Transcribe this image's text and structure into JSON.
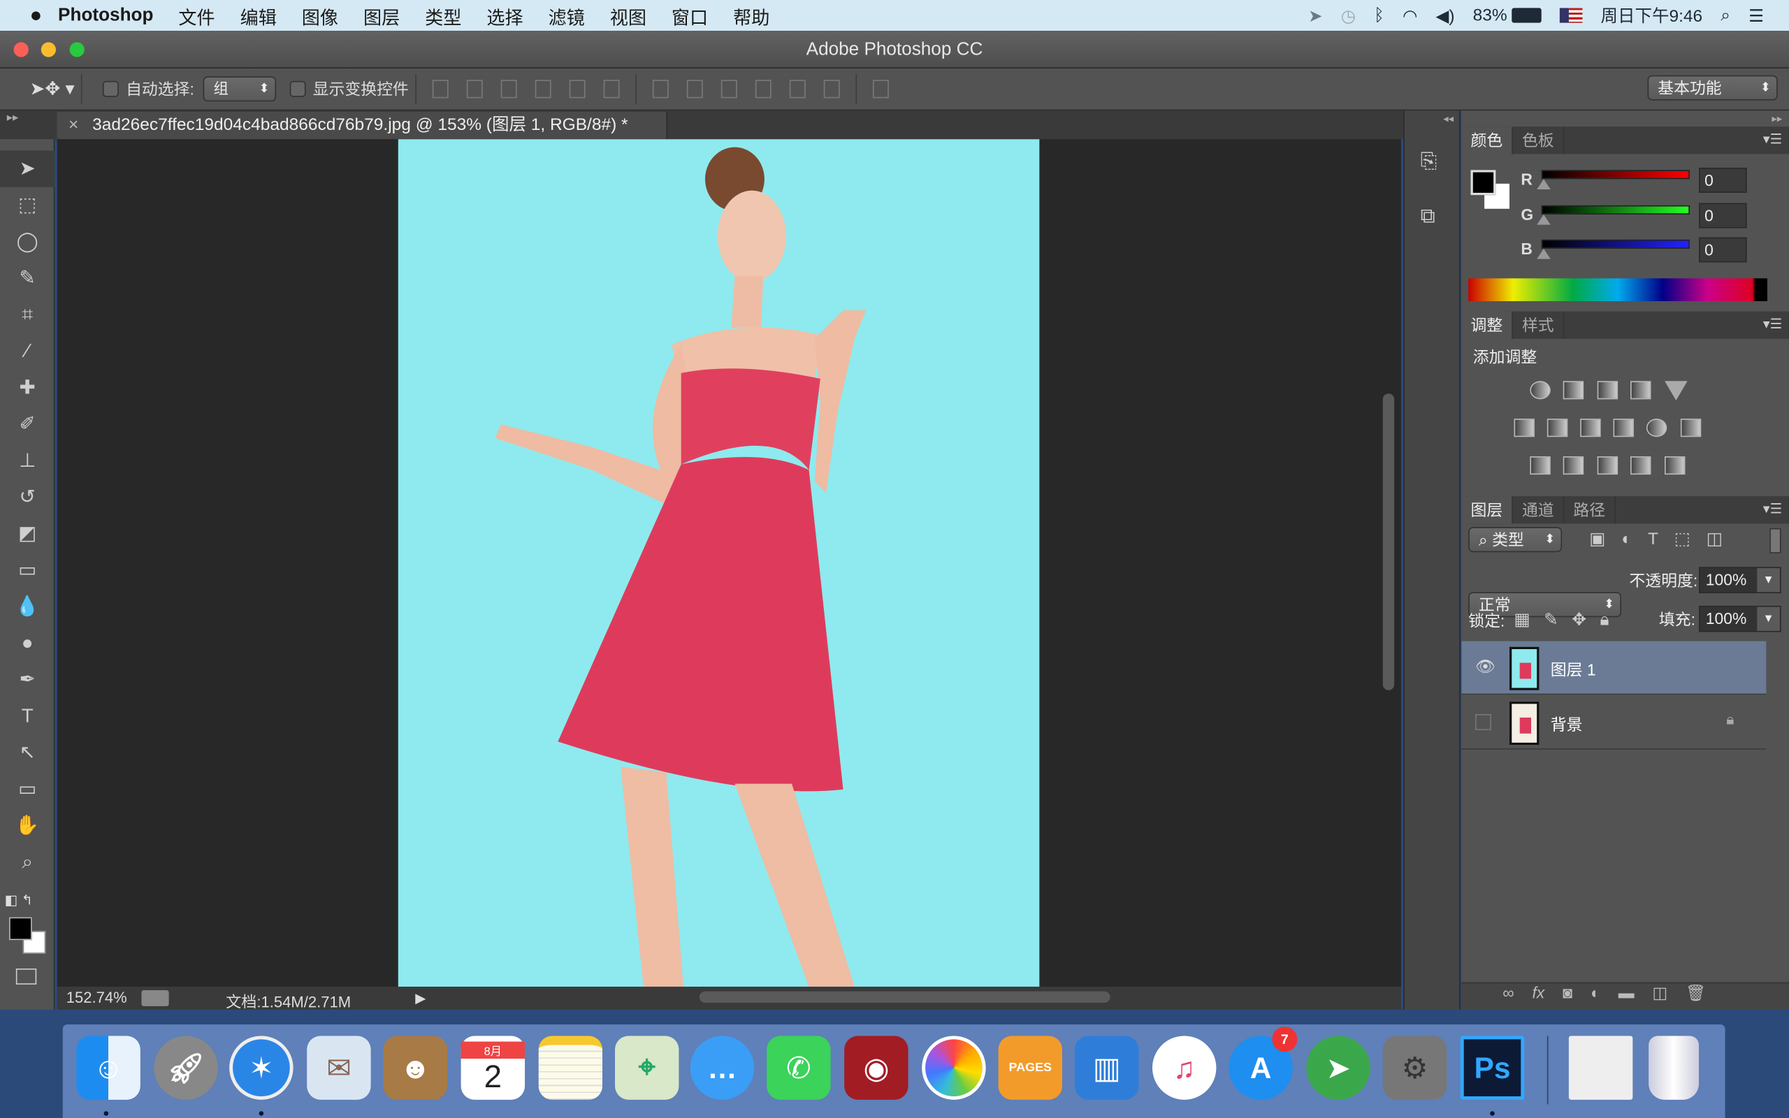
{
  "menubar": {
    "app": "Photoshop",
    "items": [
      "文件",
      "编辑",
      "图像",
      "图层",
      "类型",
      "选择",
      "滤镜",
      "视图",
      "窗口",
      "帮助"
    ],
    "battery": "83%",
    "clock": "周日下午9:46"
  },
  "window": {
    "title": "Adobe Photoshop CC"
  },
  "options": {
    "auto_select_label": "自动选择:",
    "auto_select_value": "组",
    "show_transform_label": "显示变换控件",
    "workspace": "基本功能"
  },
  "document": {
    "tab": "3ad26ec7ffec19d04c4bad866cd76b79.jpg @ 153% (图层 1, RGB/8#) *",
    "close": "×",
    "background_color": "#8eeaee"
  },
  "status": {
    "zoom": "152.74%",
    "doc_size": "文档:1.54M/2.71M"
  },
  "color_panel": {
    "tabs": [
      "颜色",
      "色板"
    ],
    "channels": [
      {
        "label": "R",
        "value": "0"
      },
      {
        "label": "G",
        "value": "0"
      },
      {
        "label": "B",
        "value": "0"
      }
    ],
    "foreground": "#000000",
    "background": "#ffffff"
  },
  "adjust_panel": {
    "tabs": [
      "调整",
      "样式"
    ],
    "heading": "添加调整"
  },
  "layers_panel": {
    "tabs": [
      "图层",
      "通道",
      "路径"
    ],
    "filter": "类型",
    "blend_mode": "正常",
    "opacity_label": "不透明度:",
    "opacity": "100%",
    "lock_label": "锁定:",
    "fill_label": "填充:",
    "fill": "100%",
    "layers": [
      {
        "name": "图层 1",
        "visible": true,
        "selected": true
      },
      {
        "name": "背景",
        "visible": false,
        "locked": true
      }
    ]
  },
  "dock": {
    "items": [
      "finder",
      "launchpad",
      "safari",
      "mail",
      "contacts",
      "calendar",
      "notes",
      "maps",
      "messages",
      "facetime",
      "photo-booth",
      "photos",
      "pages",
      "keynote",
      "itunes",
      "app-store",
      "telegram",
      "system-preferences",
      "photoshop",
      "downloads",
      "trash"
    ],
    "calendar_month": "8月",
    "calendar_day": "2",
    "app_store_badge": "7",
    "ps_logo": "Ps"
  }
}
